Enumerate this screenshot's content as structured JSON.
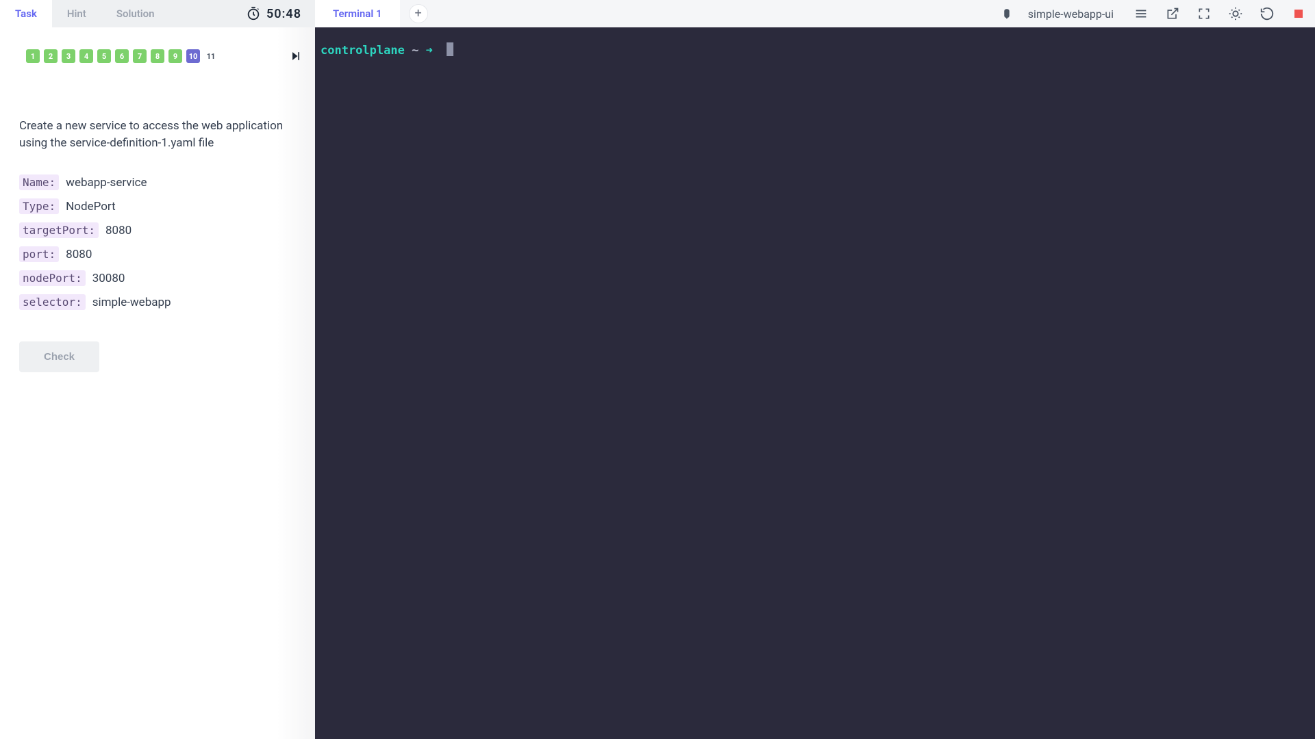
{
  "tabs": {
    "task": "Task",
    "hint": "Hint",
    "solution": "Solution"
  },
  "timer": "50:48",
  "steps": {
    "items": [
      "1",
      "2",
      "3",
      "4",
      "5",
      "6",
      "7",
      "8",
      "9",
      "10",
      "11"
    ],
    "current_index": 9
  },
  "prompt": "Create a new service to access the web application using the service-definition-1.yaml file",
  "spec": [
    {
      "key": "Name:",
      "val": "webapp-service"
    },
    {
      "key": "Type:",
      "val": "NodePort"
    },
    {
      "key": "targetPort:",
      "val": "8080"
    },
    {
      "key": "port:",
      "val": "8080"
    },
    {
      "key": "nodePort:",
      "val": "30080"
    },
    {
      "key": "selector:",
      "val": "simple-webapp"
    }
  ],
  "check_label": "Check",
  "terminal": {
    "tab_label": "Terminal 1",
    "app_label": "simple-webapp-ui",
    "prompt_host": "controlplane",
    "prompt_path": "~",
    "prompt_arrow": "➜"
  }
}
